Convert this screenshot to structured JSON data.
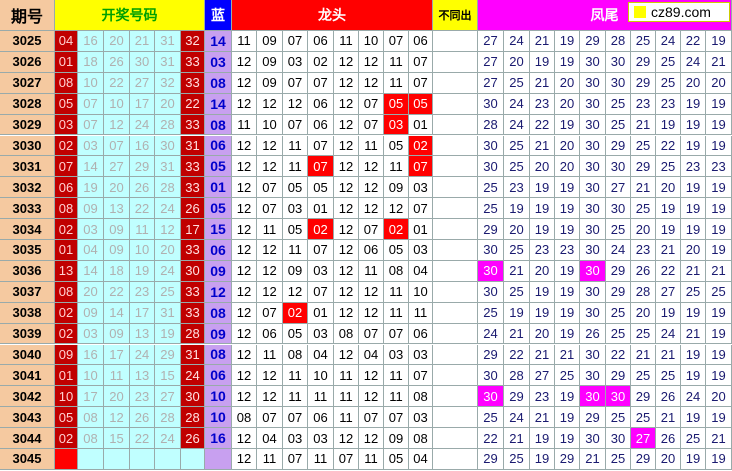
{
  "headers": {
    "period": "期号",
    "draw": "开奖号码",
    "blue": "蓝",
    "dragon": "龙头",
    "diff": "不同出",
    "phoenix": "凤尾"
  },
  "logo": "cz89.com",
  "colors": {
    "period_bg": "#f5c9a0",
    "draw_bg": "#ffff00",
    "draw_text": "#00a000",
    "dark_red": "#c00000",
    "red": "#ff0000",
    "magenta": "#ff00ff",
    "blue_head": "#0000ff",
    "blue_text": "#0000cc",
    "lavender": "#c8a0f0",
    "cyan": "#c0ffff",
    "pale_text": "#b0b0b0",
    "data_text": "#1a1a70"
  },
  "rows": [
    {
      "period": "3025",
      "reds": [
        "04",
        "16",
        "20",
        "21",
        "31",
        "32"
      ],
      "blue": "14",
      "dragon": [
        "11",
        "09",
        "07",
        "06",
        "11",
        "10",
        "07",
        "06"
      ],
      "diff": "",
      "phoenix": [
        "27",
        "24",
        "21",
        "19",
        "29",
        "28",
        "25",
        "24",
        "22",
        "19"
      ]
    },
    {
      "period": "3026",
      "reds": [
        "01",
        "18",
        "26",
        "30",
        "31",
        "33"
      ],
      "blue": "03",
      "dragon": [
        "12",
        "09",
        "03",
        "02",
        "12",
        "12",
        "11",
        "07"
      ],
      "diff": "",
      "phoenix": [
        "27",
        "20",
        "19",
        "19",
        "30",
        "30",
        "29",
        "25",
        "24",
        "21"
      ]
    },
    {
      "period": "3027",
      "reds": [
        "08",
        "10",
        "22",
        "27",
        "32",
        "33"
      ],
      "blue": "08",
      "dragon": [
        "12",
        "09",
        "07",
        "07",
        "12",
        "12",
        "11",
        "07"
      ],
      "diff": "",
      "phoenix": [
        "27",
        "25",
        "21",
        "20",
        "30",
        "30",
        "29",
        "25",
        "20",
        "20"
      ]
    },
    {
      "period": "3028",
      "reds": [
        "05",
        "07",
        "10",
        "17",
        "20",
        "22"
      ],
      "blue": "14",
      "dragon": [
        "12",
        "12",
        "12",
        "06",
        "12",
        "07",
        "05",
        "05"
      ],
      "diff": "",
      "phoenix": [
        "30",
        "24",
        "23",
        "20",
        "30",
        "25",
        "23",
        "23",
        "19",
        "19"
      ]
    },
    {
      "period": "3029",
      "reds": [
        "03",
        "07",
        "12",
        "24",
        "28",
        "33"
      ],
      "blue": "08",
      "dragon": [
        "11",
        "10",
        "07",
        "06",
        "12",
        "07",
        "03",
        "01"
      ],
      "diff": "",
      "phoenix": [
        "28",
        "24",
        "22",
        "19",
        "30",
        "25",
        "21",
        "19",
        "19",
        "19"
      ]
    },
    {
      "period": "3030",
      "reds": [
        "02",
        "03",
        "07",
        "16",
        "30",
        "31"
      ],
      "blue": "06",
      "dragon": [
        "12",
        "12",
        "11",
        "07",
        "12",
        "11",
        "05",
        "02"
      ],
      "diff": "",
      "phoenix": [
        "30",
        "25",
        "21",
        "20",
        "30",
        "29",
        "25",
        "22",
        "19",
        "19"
      ]
    },
    {
      "period": "3031",
      "reds": [
        "07",
        "14",
        "27",
        "29",
        "31",
        "33"
      ],
      "blue": "05",
      "dragon": [
        "12",
        "12",
        "11",
        "07",
        "12",
        "12",
        "11",
        "07"
      ],
      "diff": "",
      "phoenix": [
        "30",
        "25",
        "20",
        "20",
        "30",
        "30",
        "29",
        "25",
        "23",
        "23"
      ]
    },
    {
      "period": "3032",
      "reds": [
        "06",
        "19",
        "20",
        "26",
        "28",
        "33"
      ],
      "blue": "01",
      "dragon": [
        "12",
        "07",
        "05",
        "05",
        "12",
        "12",
        "09",
        "03"
      ],
      "diff": "",
      "phoenix": [
        "25",
        "23",
        "19",
        "19",
        "30",
        "27",
        "21",
        "20",
        "19",
        "19"
      ]
    },
    {
      "period": "3033",
      "reds": [
        "08",
        "09",
        "13",
        "22",
        "24",
        "26"
      ],
      "blue": "05",
      "dragon": [
        "12",
        "07",
        "03",
        "01",
        "12",
        "12",
        "12",
        "07"
      ],
      "diff": "",
      "phoenix": [
        "25",
        "19",
        "19",
        "19",
        "30",
        "30",
        "25",
        "19",
        "19",
        "19"
      ]
    },
    {
      "period": "3034",
      "reds": [
        "02",
        "03",
        "09",
        "11",
        "12",
        "17"
      ],
      "blue": "15",
      "dragon": [
        "12",
        "11",
        "05",
        "02",
        "12",
        "07",
        "02",
        "01"
      ],
      "diff": "",
      "phoenix": [
        "29",
        "20",
        "19",
        "19",
        "30",
        "25",
        "20",
        "19",
        "19",
        "19"
      ]
    },
    {
      "period": "3035",
      "reds": [
        "01",
        "04",
        "09",
        "10",
        "20",
        "33"
      ],
      "blue": "06",
      "dragon": [
        "12",
        "12",
        "11",
        "07",
        "12",
        "06",
        "05",
        "03"
      ],
      "diff": "",
      "phoenix": [
        "30",
        "25",
        "23",
        "23",
        "30",
        "24",
        "23",
        "21",
        "20",
        "19"
      ]
    },
    {
      "period": "3036",
      "reds": [
        "13",
        "14",
        "18",
        "19",
        "24",
        "30"
      ],
      "blue": "09",
      "dragon": [
        "12",
        "12",
        "09",
        "03",
        "12",
        "11",
        "08",
        "04"
      ],
      "diff": "",
      "phoenix": [
        "30",
        "21",
        "20",
        "19",
        "30",
        "29",
        "26",
        "22",
        "21",
        "21"
      ]
    },
    {
      "period": "3037",
      "reds": [
        "08",
        "20",
        "22",
        "23",
        "25",
        "33"
      ],
      "blue": "12",
      "dragon": [
        "12",
        "12",
        "12",
        "07",
        "12",
        "12",
        "11",
        "10"
      ],
      "diff": "",
      "phoenix": [
        "30",
        "25",
        "19",
        "19",
        "30",
        "29",
        "28",
        "27",
        "25",
        "25"
      ]
    },
    {
      "period": "3038",
      "reds": [
        "02",
        "09",
        "14",
        "17",
        "31",
        "33"
      ],
      "blue": "08",
      "dragon": [
        "12",
        "07",
        "02",
        "01",
        "12",
        "12",
        "11",
        "11"
      ],
      "diff": "",
      "phoenix": [
        "25",
        "19",
        "19",
        "19",
        "30",
        "25",
        "20",
        "19",
        "19",
        "19"
      ]
    },
    {
      "period": "3039",
      "reds": [
        "02",
        "03",
        "09",
        "13",
        "19",
        "28"
      ],
      "blue": "09",
      "dragon": [
        "12",
        "06",
        "05",
        "03",
        "08",
        "07",
        "07",
        "06"
      ],
      "diff": "",
      "phoenix": [
        "24",
        "21",
        "20",
        "19",
        "26",
        "25",
        "25",
        "24",
        "21",
        "19"
      ]
    },
    {
      "period": "3040",
      "reds": [
        "09",
        "16",
        "17",
        "24",
        "29",
        "31"
      ],
      "blue": "08",
      "dragon": [
        "12",
        "11",
        "08",
        "04",
        "12",
        "04",
        "03",
        "03"
      ],
      "diff": "",
      "phoenix": [
        "29",
        "22",
        "21",
        "21",
        "30",
        "22",
        "21",
        "21",
        "19",
        "19"
      ]
    },
    {
      "period": "3041",
      "reds": [
        "01",
        "10",
        "11",
        "13",
        "15",
        "24"
      ],
      "blue": "06",
      "dragon": [
        "12",
        "12",
        "11",
        "10",
        "11",
        "12",
        "11",
        "07"
      ],
      "diff": "",
      "phoenix": [
        "30",
        "28",
        "27",
        "25",
        "30",
        "29",
        "25",
        "25",
        "19",
        "19"
      ]
    },
    {
      "period": "3042",
      "reds": [
        "10",
        "17",
        "20",
        "23",
        "27",
        "30"
      ],
      "blue": "10",
      "dragon": [
        "12",
        "12",
        "11",
        "11",
        "11",
        "12",
        "11",
        "08"
      ],
      "diff": "",
      "phoenix": [
        "30",
        "29",
        "23",
        "19",
        "30",
        "30",
        "29",
        "26",
        "24",
        "20"
      ]
    },
    {
      "period": "3043",
      "reds": [
        "05",
        "08",
        "12",
        "26",
        "28",
        "28"
      ],
      "blue": "10",
      "dragon": [
        "08",
        "07",
        "07",
        "06",
        "11",
        "07",
        "07",
        "03"
      ],
      "diff": "",
      "phoenix": [
        "25",
        "24",
        "21",
        "19",
        "29",
        "25",
        "25",
        "21",
        "19",
        "19"
      ]
    },
    {
      "period": "3044",
      "reds": [
        "02",
        "08",
        "15",
        "22",
        "24",
        "26"
      ],
      "blue": "16",
      "dragon": [
        "12",
        "04",
        "03",
        "03",
        "12",
        "12",
        "09",
        "08"
      ],
      "diff": "",
      "phoenix": [
        "22",
        "21",
        "19",
        "19",
        "30",
        "30",
        "27",
        "26",
        "25",
        "21"
      ]
    },
    {
      "period": "3045",
      "reds": [
        "",
        "",
        "",
        "",
        "",
        ""
      ],
      "blue": "",
      "dragon": [
        "12",
        "11",
        "07",
        "11",
        "07",
        "11",
        "05",
        "04"
      ],
      "diff": "",
      "phoenix": [
        "29",
        "25",
        "19",
        "29",
        "21",
        "25",
        "29",
        "20",
        "19",
        "19"
      ]
    }
  ],
  "highlights": {
    "dragon_red": [
      [
        3,
        6
      ],
      [
        3,
        7
      ],
      [
        4,
        6
      ],
      [
        5,
        7
      ],
      [
        6,
        3
      ],
      [
        6,
        7
      ],
      [
        9,
        3
      ],
      [
        9,
        6
      ],
      [
        13,
        2
      ]
    ],
    "phoenix_magenta": [
      [
        11,
        0
      ],
      [
        11,
        4
      ],
      [
        17,
        0
      ],
      [
        17,
        4
      ],
      [
        17,
        5
      ],
      [
        19,
        6
      ]
    ]
  }
}
